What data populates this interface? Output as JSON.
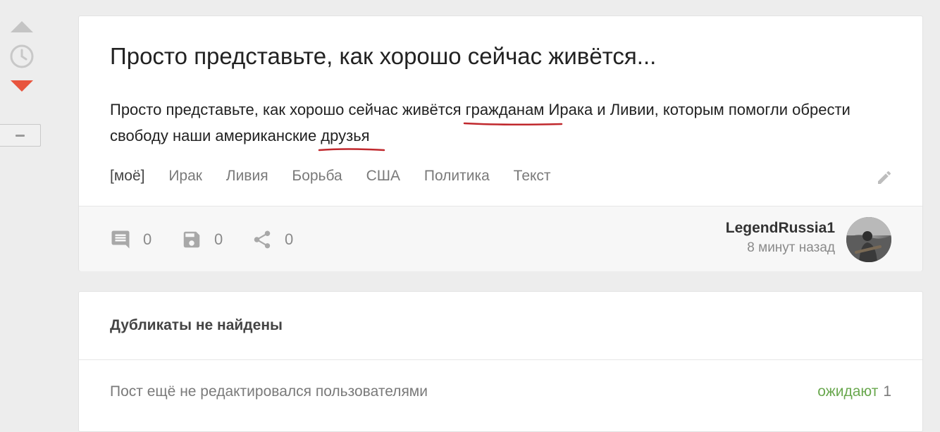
{
  "post": {
    "title": "Просто представьте, как хорошо сейчас живётся...",
    "text_part1": "Просто представьте, как хорошо сейчас живётся ",
    "text_underlined1": "гражданам",
    "text_part2": " Ирака и Ливии, которым помогли обрести свободу наши американские ",
    "text_underlined2": "друзья",
    "underline_color": "#c0282d",
    "tags": [
      "[моё]",
      "Ирак",
      "Ливия",
      "Борьба",
      "США",
      "Политика",
      "Текст"
    ]
  },
  "stats": {
    "comments": "0",
    "saves": "0",
    "shares": "0"
  },
  "author": {
    "name": "LegendRussia1",
    "time": "8 минут назад"
  },
  "duplicates": {
    "title": "Дубликаты не найдены",
    "status": "Пост ещё не редактировался пользователями",
    "waiting_label": "ожидают",
    "waiting_count": "1"
  },
  "colors": {
    "vote_down": "#e8553e",
    "waiting": "#6aa84f"
  },
  "icons": [
    "vote-up-icon",
    "clock-icon",
    "vote-down-icon",
    "pencil-icon",
    "comment-icon",
    "save-icon",
    "share-icon"
  ]
}
